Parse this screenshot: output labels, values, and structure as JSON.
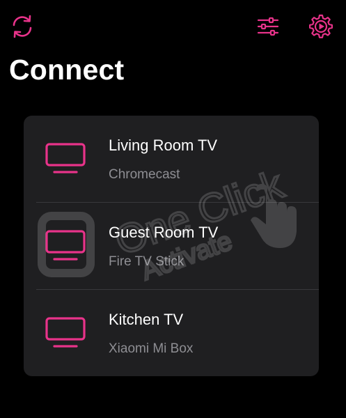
{
  "colors": {
    "accent": "#e8338a",
    "background": "#000000",
    "card": "#1f1f21",
    "secondary_text": "#8e8e93"
  },
  "header": {
    "title": "Connect",
    "icons": [
      "refresh-icon",
      "sliders-icon",
      "gear-icon"
    ]
  },
  "devices": [
    {
      "name": "Living Room TV",
      "type": "Chromecast",
      "icon": "tv-icon"
    },
    {
      "name": "Guest Room TV",
      "type": "Fire TV Stick",
      "icon": "tv-icon"
    },
    {
      "name": "Kitchen TV",
      "type": "Xiaomi Mi Box",
      "icon": "tv-icon"
    }
  ],
  "watermark": {
    "line1": "One Click",
    "line2": "Activate"
  }
}
